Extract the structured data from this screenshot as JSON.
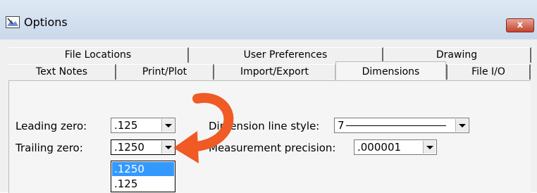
{
  "window": {
    "title": "Options",
    "close_glyph": "x"
  },
  "tabs": {
    "back_row": [
      "File Locations",
      "User Preferences",
      "Drawing"
    ],
    "front_row": [
      "Text Notes",
      "Print/Plot",
      "Import/Export",
      "Dimensions",
      "File I/O"
    ],
    "active": "Dimensions"
  },
  "fields": {
    "leading_zero": {
      "label": "Leading zero:",
      "value": ".125"
    },
    "trailing_zero": {
      "label": "Trailing zero:",
      "value": ".1250"
    },
    "dimension_line_style": {
      "label": "Dimension line style:",
      "value": "7"
    },
    "measurement_precision": {
      "label": "Measurement precision:",
      "value": ".000001"
    }
  },
  "trailing_zero_options": [
    {
      "label": ".1250",
      "selected": true
    },
    {
      "label": ".125",
      "selected": false
    }
  ],
  "colors": {
    "highlight": "#3399ff",
    "callout_arrow": "#f05a24",
    "close_button": "#c4432b"
  },
  "icons": [
    "app-options-icon",
    "close-icon",
    "dropdown-arrow-icon",
    "callout-arrow-icon"
  ]
}
